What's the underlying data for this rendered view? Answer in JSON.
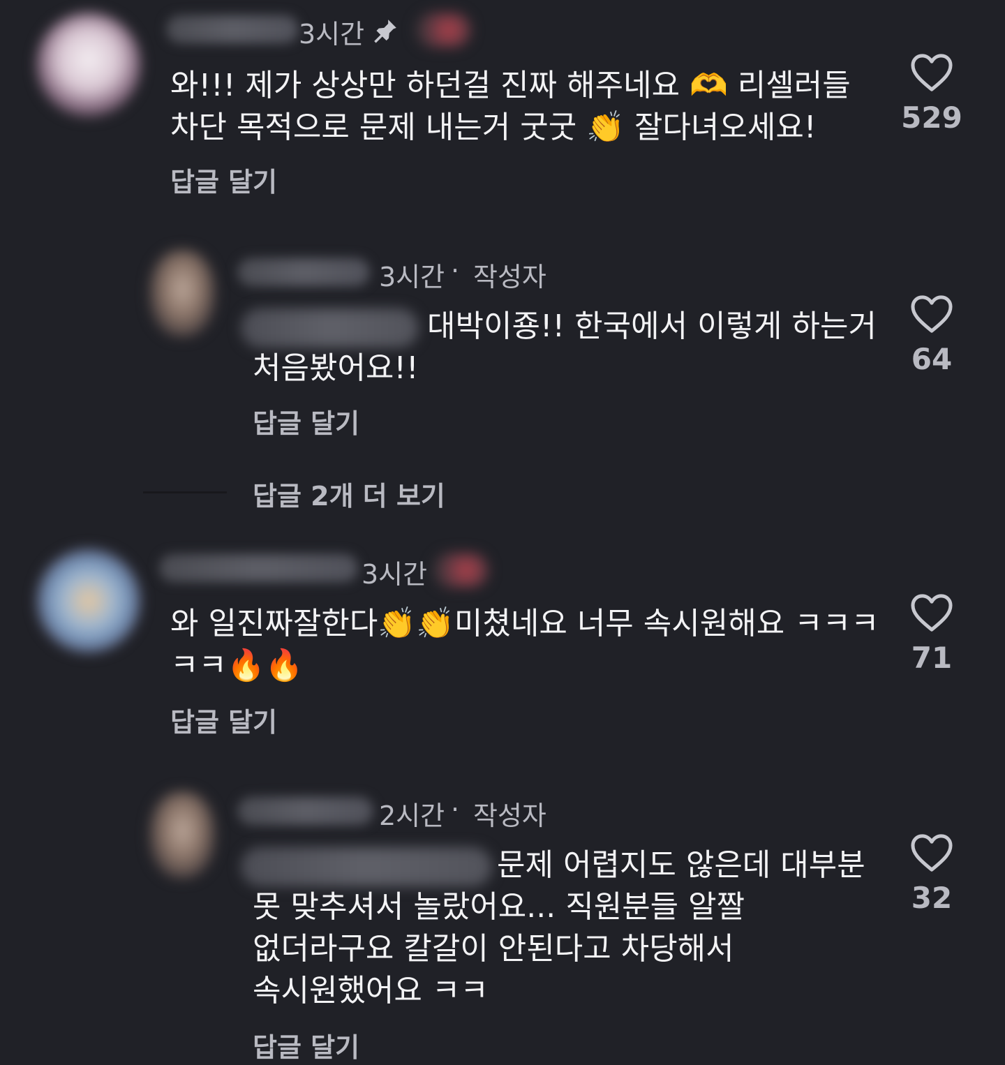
{
  "comments": [
    {
      "time": "3시간",
      "pinned": true,
      "lines": [
        "와!!! 제가 상상만 하던걸 진짜 해주네요 🫶 리셀러들",
        "차단 목적으로 문제 내는거 굿굿 👏 잘다녀오세요!"
      ],
      "reply_label": "답글 달기",
      "likes": "529"
    },
    {
      "time": "3시간",
      "author_tag": "작성자",
      "lines": [
        "대박이죵!! 한국에서 이렇게 하는거",
        "처음봤어요!!"
      ],
      "reply_label": "답글 달기",
      "likes": "64"
    },
    {
      "time": "3시간",
      "lines": [
        "와 일진짜잘한다👏👏미쳤네요 너무 속시원해요 ㅋㅋㅋ",
        "ㅋㅋ🔥🔥"
      ],
      "reply_label": "답글 달기",
      "likes": "71"
    },
    {
      "time": "2시간",
      "author_tag": "작성자",
      "lines": [
        "문제 어렵지도 않은데 대부분",
        "못 맞추셔서 놀랐어요... 직원분들 알짤",
        "없더라구요 칼갈이 안된다고 차당해서",
        "속시원했어요 ㅋㅋ"
      ],
      "reply_label": "답글 달기",
      "likes": "32"
    }
  ],
  "more_replies_label": "답글 2개 더 보기",
  "meta_separator": "·",
  "icons": {
    "pin": "pin-icon",
    "heart": "heart-icon"
  },
  "colors": {
    "background": "#202127",
    "text": "#f3f3f5",
    "secondary": "#b9bac2"
  }
}
